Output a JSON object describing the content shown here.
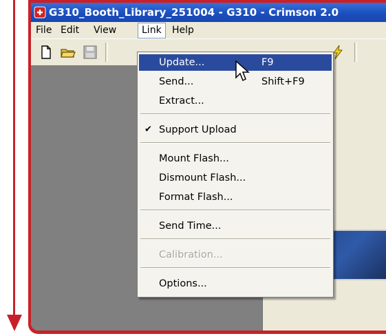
{
  "window": {
    "title": "G310_Booth_Library_251004 - G310 - Crimson 2.0",
    "app_icon": "crimson-logo-icon"
  },
  "menubar": {
    "items": [
      "File",
      "Edit",
      "View",
      "Link",
      "Help"
    ],
    "open_menu": "Link"
  },
  "toolbar": {
    "icons": [
      "new-file-icon",
      "open-folder-icon",
      "save-icon",
      "lightning-icon"
    ]
  },
  "link_menu": {
    "update": {
      "label": "Update...",
      "shortcut": "F9"
    },
    "send": {
      "label": "Send...",
      "shortcut": "Shift+F9"
    },
    "extract": {
      "label": "Extract..."
    },
    "support_upload": {
      "label": "Support Upload",
      "checked": true
    },
    "mount_flash": {
      "label": "Mount Flash..."
    },
    "dismount_flash": {
      "label": "Dismount Flash..."
    },
    "format_flash": {
      "label": "Format Flash..."
    },
    "send_time": {
      "label": "Send Time..."
    },
    "calibration": {
      "label": "Calibration...",
      "disabled": true
    },
    "options": {
      "label": "Options..."
    }
  },
  "colors": {
    "highlight": "#2a4a9e",
    "frame_red": "#c82228",
    "titlebar_blue": "#1a4fbf"
  }
}
